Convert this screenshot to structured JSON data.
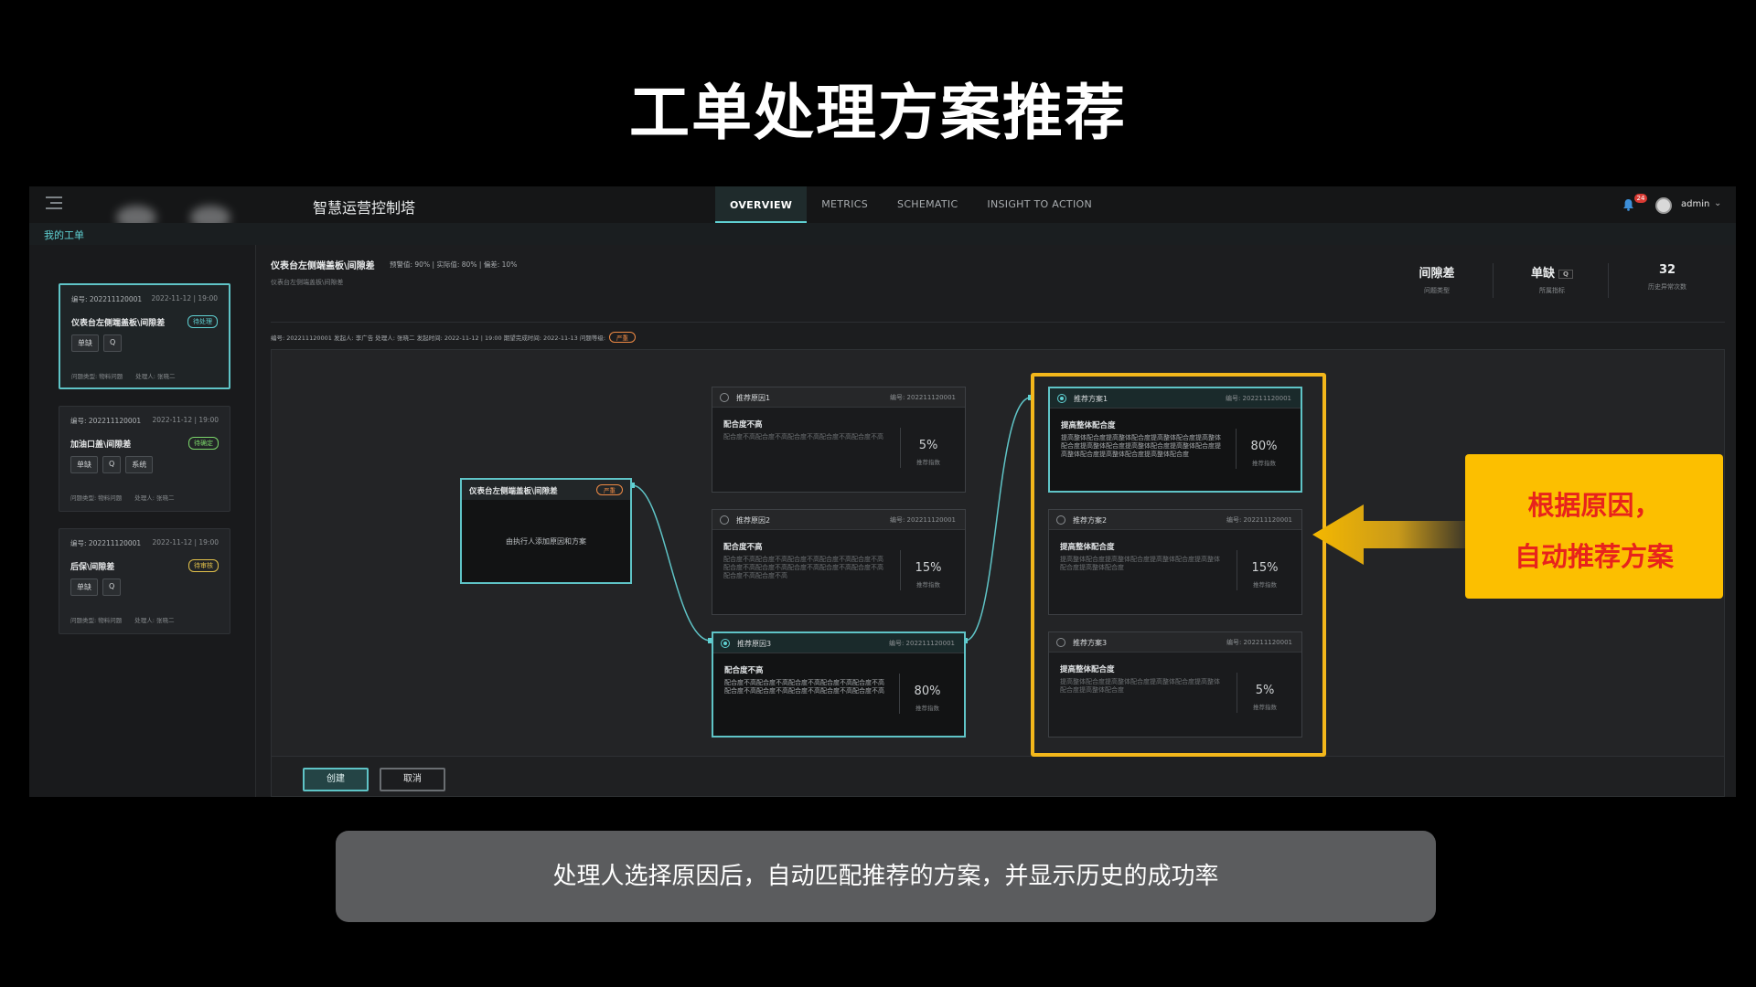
{
  "slide_title": "工单处理方案推荐",
  "app": {
    "name": "智慧运营控制塔",
    "nav_tabs": [
      {
        "label": "OVERVIEW",
        "active": true
      },
      {
        "label": "METRICS",
        "active": false
      },
      {
        "label": "SCHEMATIC",
        "active": false
      },
      {
        "label": "INSIGHT TO ACTION",
        "active": false
      }
    ],
    "notification_count": "24",
    "user_name": "admin",
    "section_label": "我的工单"
  },
  "work_orders": [
    {
      "no": "编号: 202211120001",
      "date": "2022-11-12 | 19:00",
      "title": "仪表台左侧端盖板\\间隙差",
      "status": "待处理",
      "tags": [
        "单缺",
        "Q"
      ],
      "type": "问题类型: 物料问题",
      "handler": "处理人: 张晓二"
    },
    {
      "no": "编号: 202211120001",
      "date": "2022-11-12 | 19:00",
      "title": "加油口盖\\间隙差",
      "status": "待确定",
      "tags": [
        "单缺",
        "Q",
        "系统"
      ],
      "type": "问题类型: 物料问题",
      "handler": "处理人: 张晓二"
    },
    {
      "no": "编号: 202211120001",
      "date": "2022-11-12 | 19:00",
      "title": "后保\\间隙差",
      "status": "待审核",
      "tags": [
        "单缺",
        "Q"
      ],
      "type": "问题类型: 物料问题",
      "handler": "处理人: 张晓二"
    }
  ],
  "detail": {
    "title": "仪表台左侧端盖板\\间隙差",
    "metrics": "预警值: 90%  |  实际值: 80%  |  偏差: 10%",
    "subtitle": "仪表台左侧端盖板\\间隙差",
    "info": "编号: 202211120001    发起人: 李广告    处理人: 张晓二    发起时间: 2022-11-12 | 19:00    期望完成时间: 2022-11-13    问题等级:",
    "level": "严重",
    "stats": [
      {
        "value": "间隙差",
        "label": "问题类型",
        "q": ""
      },
      {
        "value": "单缺",
        "label": "所属指标",
        "q": "Q"
      },
      {
        "value": "32",
        "label": "历史异常次数",
        "q": ""
      }
    ]
  },
  "flow": {
    "source": {
      "title": "仪表台左侧端盖板\\间隙差",
      "tag": "严重",
      "body": "由执行人添加原因和方案"
    },
    "causes": [
      {
        "name": "推荐原因1",
        "no": "编号: 202211120001",
        "title": "配合度不高",
        "desc": "配合度不高配合度不高配合度不高配合度不高配合度不高",
        "pct": "5%",
        "pct_label": "推荐指数",
        "active": false
      },
      {
        "name": "推荐原因2",
        "no": "编号: 202211120001",
        "title": "配合度不高",
        "desc": "配合度不高配合度不高配合度不高配合度不高配合度不高配合度不高配合度不高配合度不高配合度不高配合度不高配合度不高配合度不高",
        "pct": "15%",
        "pct_label": "推荐指数",
        "active": false
      },
      {
        "name": "推荐原因3",
        "no": "编号: 202211120001",
        "title": "配合度不高",
        "desc": "配合度不高配合度不高配合度不高配合度不高配合度不高配合度不高配合度不高配合度不高配合度不高配合度不高",
        "pct": "80%",
        "pct_label": "推荐指数",
        "active": true
      }
    ],
    "solutions": [
      {
        "name": "推荐方案1",
        "no": "编号: 202211120001",
        "title": "提高整体配合度",
        "desc": "提高整体配合度提高整体配合度提高整体配合度提高整体配合度提高整体配合度提高整体配合度提高整体配合度提高整体配合度提高整体配合度提高整体配合度",
        "pct": "80%",
        "pct_label": "推荐指数",
        "active": true
      },
      {
        "name": "推荐方案2",
        "no": "编号: 202211120001",
        "title": "提高整体配合度",
        "desc": "提高整体配合度提高整体配合度提高整体配合度提高整体配合度提高整体配合度",
        "pct": "15%",
        "pct_label": "推荐指数",
        "active": false
      },
      {
        "name": "推荐方案3",
        "no": "编号: 202211120001",
        "title": "提高整体配合度",
        "desc": "提高整体配合度提高整体配合度提高整体配合度提高整体配合度提高整体配合度",
        "pct": "5%",
        "pct_label": "推荐指数",
        "active": false
      }
    ]
  },
  "buttons": {
    "create": "创建",
    "cancel": "取消"
  },
  "callout": {
    "line1": "根据原因，",
    "line2": "自动推荐方案"
  },
  "caption": "处理人选择原因后，自动匹配推荐的方案，并显示历史的成功率",
  "colors": {
    "accent": "#5fc4c7",
    "highlight": "#f3b71b",
    "callout_bg": "#fcbf00",
    "callout_text": "#e8231c",
    "severity": "#ef8a44"
  }
}
